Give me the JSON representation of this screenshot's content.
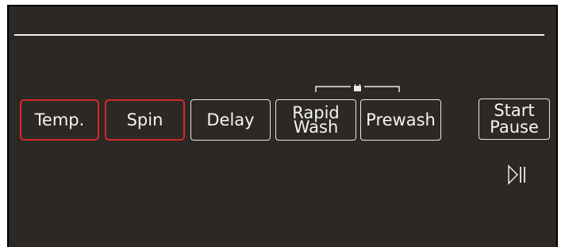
{
  "panel": {
    "buttons": {
      "temp": "Temp.",
      "spin": "Spin",
      "delay": "Delay",
      "rapid_wash_line1": "Rapid",
      "rapid_wash_line2": "Wash",
      "prewash": "Prewash",
      "start_line1": "Start",
      "start_line2": "Pause"
    },
    "highlighted_buttons": [
      "Temp.",
      "Spin"
    ],
    "colors": {
      "background": "#2c2825",
      "highlight": "#d42a2a",
      "text": "#f4f4f4"
    },
    "icons": {
      "child_lock": "lock-icon",
      "play_pause": "play-pause-icon"
    }
  }
}
